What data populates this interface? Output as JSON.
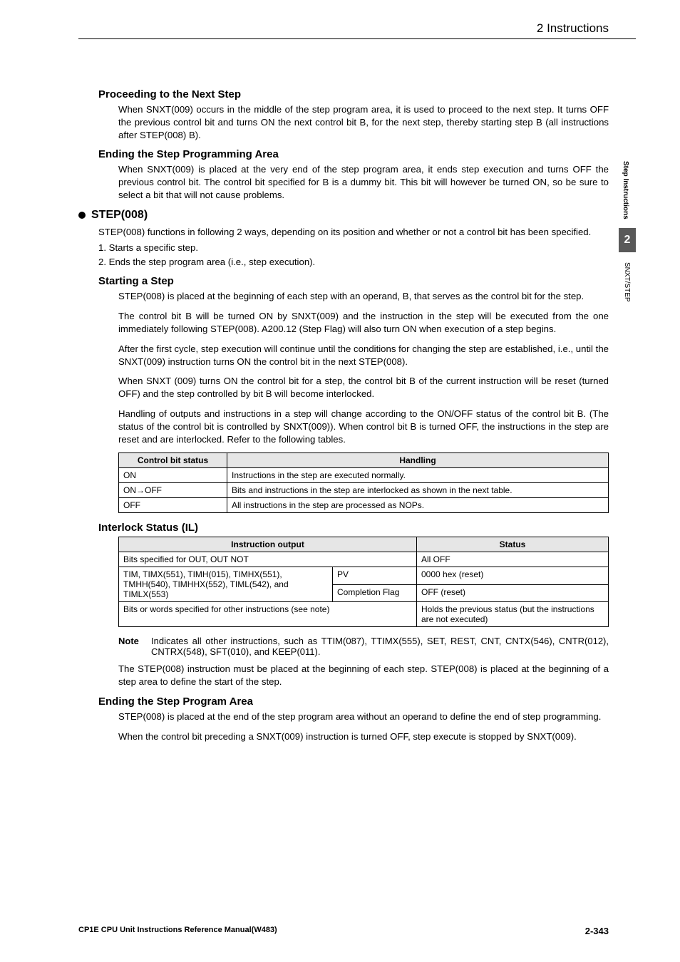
{
  "header": {
    "section": "2   Instructions"
  },
  "side": {
    "label1": "Step Instructions",
    "chapter": "2",
    "label2": "SNXT/STEP"
  },
  "s1": {
    "title": "Proceeding to the Next Step",
    "p1": "When SNXT(009) occurs in the middle of the step program area, it is used to proceed to the next step. It turns OFF the previous control bit and turns ON the next control bit B, for the next step, thereby starting step B (all instructions after STEP(008) B)."
  },
  "s2": {
    "title": "Ending the Step Programming Area",
    "p1": "When SNXT(009) is placed at the very end of the step program area, it ends step execution and turns OFF the previous control bit. The control bit specified for B is a dummy bit. This bit will however be turned ON, so be sure to select a bit that will not cause problems."
  },
  "s3": {
    "title": "STEP(008)",
    "p1": "STEP(008) functions in following 2 ways, depending on its position and whether or not a control bit has been specified.",
    "l1": "1. Starts a specific step.",
    "l2": "2. Ends the step program area (i.e., step execution)."
  },
  "s4": {
    "title": "Starting a Step",
    "p1": "STEP(008) is placed at the beginning of each step with an operand, B, that serves as the control bit for the step.",
    "p2": "The control bit B will be turned ON by SNXT(009) and the instruction in the step will be executed from the one immediately following STEP(008). A200.12 (Step Flag) will also turn ON when execution of a step begins.",
    "p3": "After the first cycle, step execution will continue until the conditions for changing the step are established, i.e., until the SNXT(009) instruction turns ON the control bit in the next STEP(008).",
    "p4": "When SNXT (009) turns ON the control bit for a step, the control bit B of the current instruction will be reset (turned OFF) and the step controlled by bit B will become interlocked.",
    "p5": "Handling of outputs and instructions in a step will change according to the ON/OFF status of the control bit B. (The status of the control bit is controlled by SNXT(009)). When control bit B is turned OFF, the instructions in the step are reset and are interlocked. Refer to the following tables."
  },
  "t1": {
    "h1": "Control bit status",
    "h2": "Handling",
    "r1c1": "ON",
    "r1c2": "Instructions in the step are executed normally.",
    "r2c1": "ON→OFF",
    "r2c2": "Bits and instructions in the step are interlocked as shown in the next table.",
    "r3c1": "OFF",
    "r3c2": "All instructions in the step are processed as NOPs."
  },
  "s5": {
    "title": "Interlock Status (IL)"
  },
  "t2": {
    "h1": "Instruction output",
    "h2": "Status",
    "r1c1": "Bits specified for OUT, OUT NOT",
    "r1c2": "All OFF",
    "r2c1": "TIM, TIMX(551), TIMH(015), TIMHX(551), TMHH(540), TIMHHX(552), TIML(542), and TIMLX(553)",
    "r2c2a": "PV",
    "r2c2b": "0000 hex (reset)",
    "r2c3a": "Completion Flag",
    "r2c3b": "OFF (reset)",
    "r3c1": "Bits or words specified for other instructions (see note)",
    "r3c2": "Holds the previous status (but the instructions are not executed)"
  },
  "note": {
    "label": "Note",
    "text": "Indicates all other instructions, such as TTIM(087), TTIMX(555), SET, REST, CNT, CNTX(546), CNTR(012), CNTRX(548), SFT(010), and KEEP(011)."
  },
  "s6": {
    "p1": "The STEP(008) instruction must be placed at the beginning of each step. STEP(008) is placed at the beginning of a step area to define the start of the step."
  },
  "s7": {
    "title": "Ending the Step Program Area",
    "p1": "STEP(008) is placed at the end of the step program area without an operand to define the end of step programming.",
    "p2": "When the control bit preceding a SNXT(009) instruction is turned OFF, step execute is stopped by SNXT(009)."
  },
  "footer": {
    "left": "CP1E CPU Unit Instructions Reference Manual(W483)",
    "right": "2-343"
  }
}
